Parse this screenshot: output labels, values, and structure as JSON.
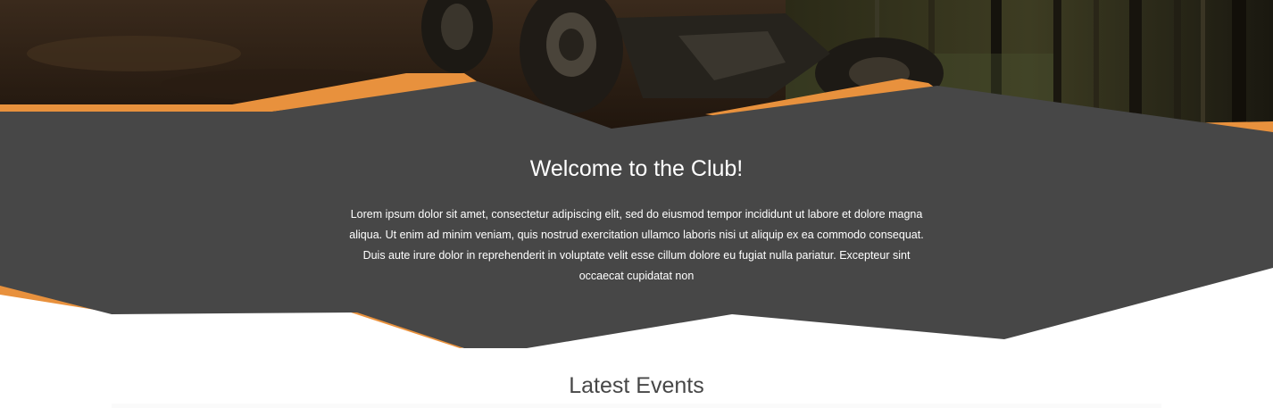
{
  "colors": {
    "accent": "#e8913d",
    "panel": "#474747",
    "text_light": "#ffffff",
    "text_dark": "#474747"
  },
  "hero": {
    "image": "atv-offroad-forest-photo"
  },
  "welcome": {
    "title": "Welcome to the Club!",
    "body": "Lorem ipsum dolor sit amet, consectetur adipiscing elit, sed do eiusmod tempor incididunt ut labore et dolore magna aliqua. Ut enim ad minim veniam, quis nostrud exercitation ullamco laboris nisi ut aliquip ex ea commodo consequat. Duis aute irure dolor in reprehenderit in voluptate velit esse cillum dolore eu fugiat nulla pariatur. Excepteur sint occaecat cupidatat non"
  },
  "events": {
    "title": "Latest Events"
  }
}
